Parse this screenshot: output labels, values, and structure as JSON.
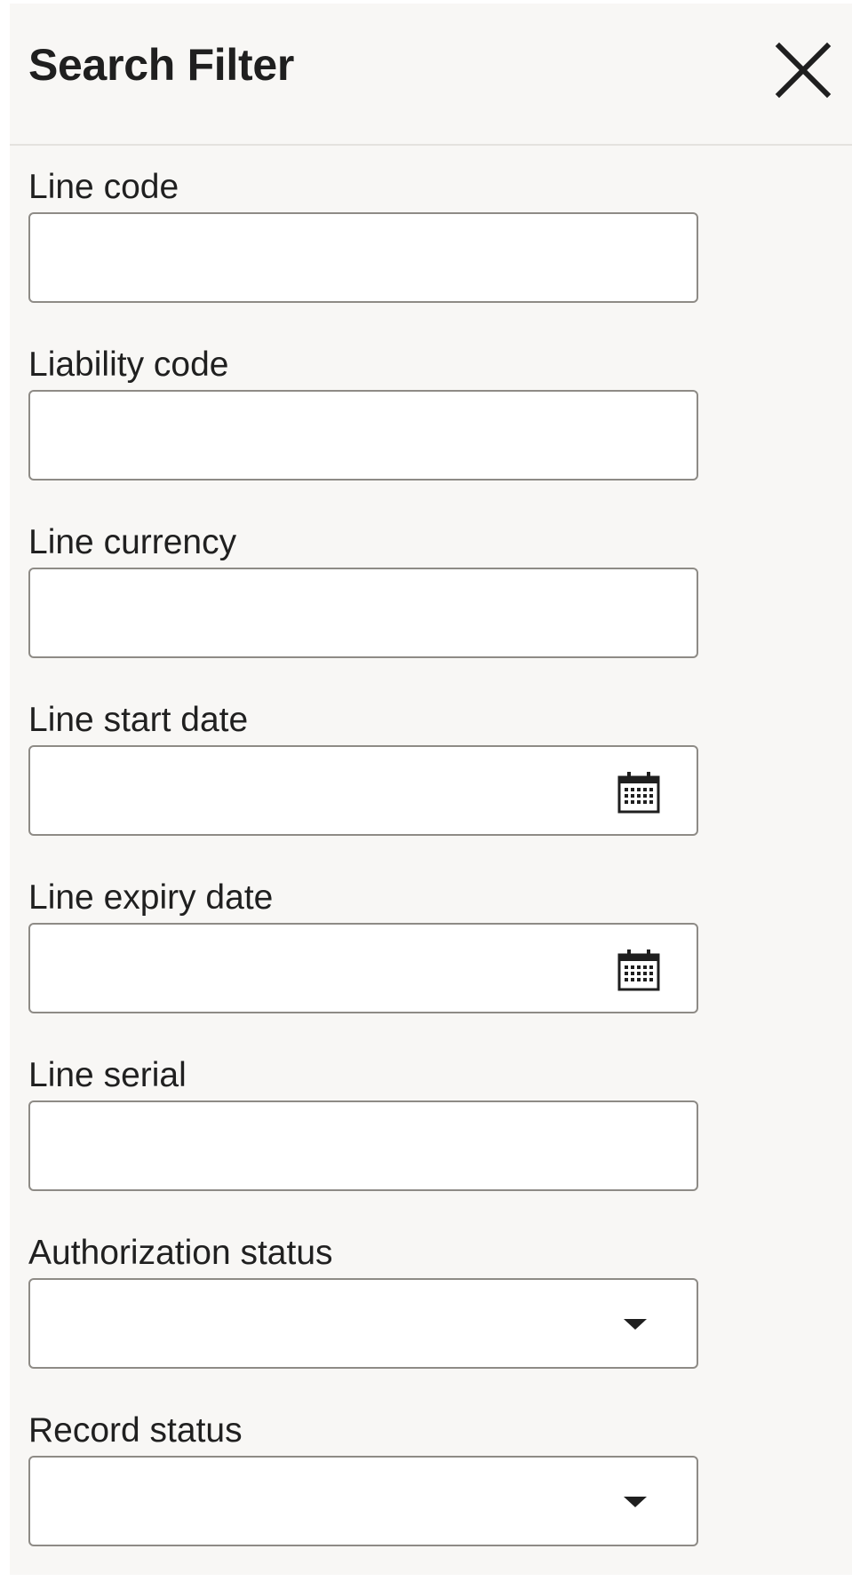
{
  "header": {
    "title": "Search Filter",
    "close_icon": "close-icon"
  },
  "fields": [
    {
      "label": "Line code",
      "type": "text",
      "value": ""
    },
    {
      "label": "Liability code",
      "type": "text",
      "value": ""
    },
    {
      "label": "Line currency",
      "type": "text",
      "value": ""
    },
    {
      "label": "Line start date",
      "type": "date",
      "value": "",
      "icon": "calendar-icon"
    },
    {
      "label": "Line expiry date",
      "type": "date",
      "value": "",
      "icon": "calendar-icon"
    },
    {
      "label": "Line serial",
      "type": "text",
      "value": ""
    },
    {
      "label": "Authorization status",
      "type": "select",
      "value": "",
      "icon": "chevron-down-icon"
    },
    {
      "label": "Record status",
      "type": "select",
      "value": "",
      "icon": "chevron-down-icon"
    }
  ],
  "colors": {
    "panel_bg": "#f8f7f5",
    "input_border": "#8e8b86",
    "text": "#202020"
  }
}
